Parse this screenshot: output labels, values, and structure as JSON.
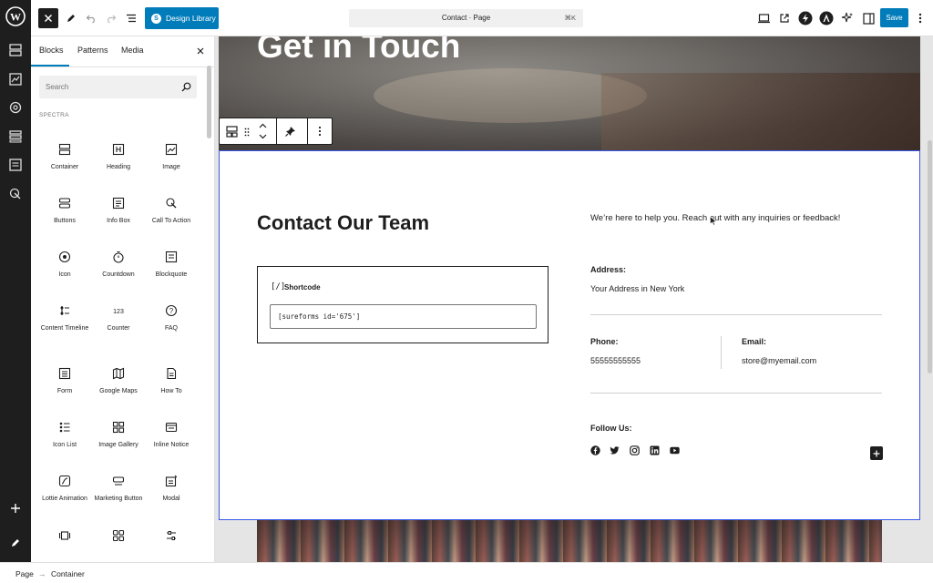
{
  "admin_sidebar": {
    "items": [
      "wordpress-logo",
      "layout-icon",
      "media-icon",
      "styles-icon",
      "templates-icon",
      "pages-icon",
      "navigation-icon",
      "add-icon",
      "edit-icon"
    ]
  },
  "toolbar": {
    "design_library": "Design Library",
    "doc_title": "Contact · Page",
    "shortcut": "⌘K",
    "save": "Save"
  },
  "inserter": {
    "tabs": [
      "Blocks",
      "Patterns",
      "Media"
    ],
    "search_placeholder": "Search",
    "section": "SPECTRA",
    "blocks": [
      {
        "label": "Container",
        "icon": "container-icon"
      },
      {
        "label": "Heading",
        "icon": "heading-icon"
      },
      {
        "label": "Image",
        "icon": "image-icon"
      },
      {
        "label": "Buttons",
        "icon": "buttons-icon"
      },
      {
        "label": "Info Box",
        "icon": "info-box-icon"
      },
      {
        "label": "Call To Action",
        "icon": "call-to-action-icon"
      },
      {
        "label": "Icon",
        "icon": "icon-icon"
      },
      {
        "label": "Countdown",
        "icon": "countdown-icon"
      },
      {
        "label": "Blockquote",
        "icon": "blockquote-icon"
      },
      {
        "label": "Content Timeline",
        "icon": "content-timeline-icon"
      },
      {
        "label": "Counter",
        "icon": "counter-icon"
      },
      {
        "label": "FAQ",
        "icon": "faq-icon"
      },
      {
        "label": "Form",
        "icon": "form-icon"
      },
      {
        "label": "Google Maps",
        "icon": "google-maps-icon"
      },
      {
        "label": "How To",
        "icon": "how-to-icon"
      },
      {
        "label": "Icon List",
        "icon": "icon-list-icon"
      },
      {
        "label": "Image Gallery",
        "icon": "image-gallery-icon"
      },
      {
        "label": "Inline Notice",
        "icon": "inline-notice-icon"
      },
      {
        "label": "Lottie Animation",
        "icon": "lottie-icon"
      },
      {
        "label": "Marketing Button",
        "icon": "marketing-button-icon"
      },
      {
        "label": "Modal",
        "icon": "modal-icon"
      },
      {
        "label": "",
        "icon": "post-carousel-icon"
      },
      {
        "label": "",
        "icon": "post-grid-icon"
      },
      {
        "label": "",
        "icon": "slider-icon"
      }
    ]
  },
  "content": {
    "hero_heading": "Get in Touch",
    "section_heading": "Contact Our Team",
    "intro": "We’re here to help you. Reach out with any inquiries or feedback!",
    "shortcode_label": "Shortcode",
    "shortcode_value": "[sureforms id='675']",
    "address_label": "Address:",
    "address_value": "Your Address in New York",
    "phone_label": "Phone:",
    "phone_value": "55555555555",
    "email_label": "Email:",
    "email_value": "store@myemail.com",
    "follow_label": "Follow Us:",
    "socials": [
      "facebook-icon",
      "twitter-icon",
      "instagram-icon",
      "linkedin-icon",
      "youtube-icon"
    ]
  },
  "breadcrumb": {
    "items": [
      "Page",
      "Container"
    ],
    "separator": "→"
  },
  "colors": {
    "accent": "#007cba",
    "dark": "#1e1e1e",
    "selection": "#3858e9"
  }
}
